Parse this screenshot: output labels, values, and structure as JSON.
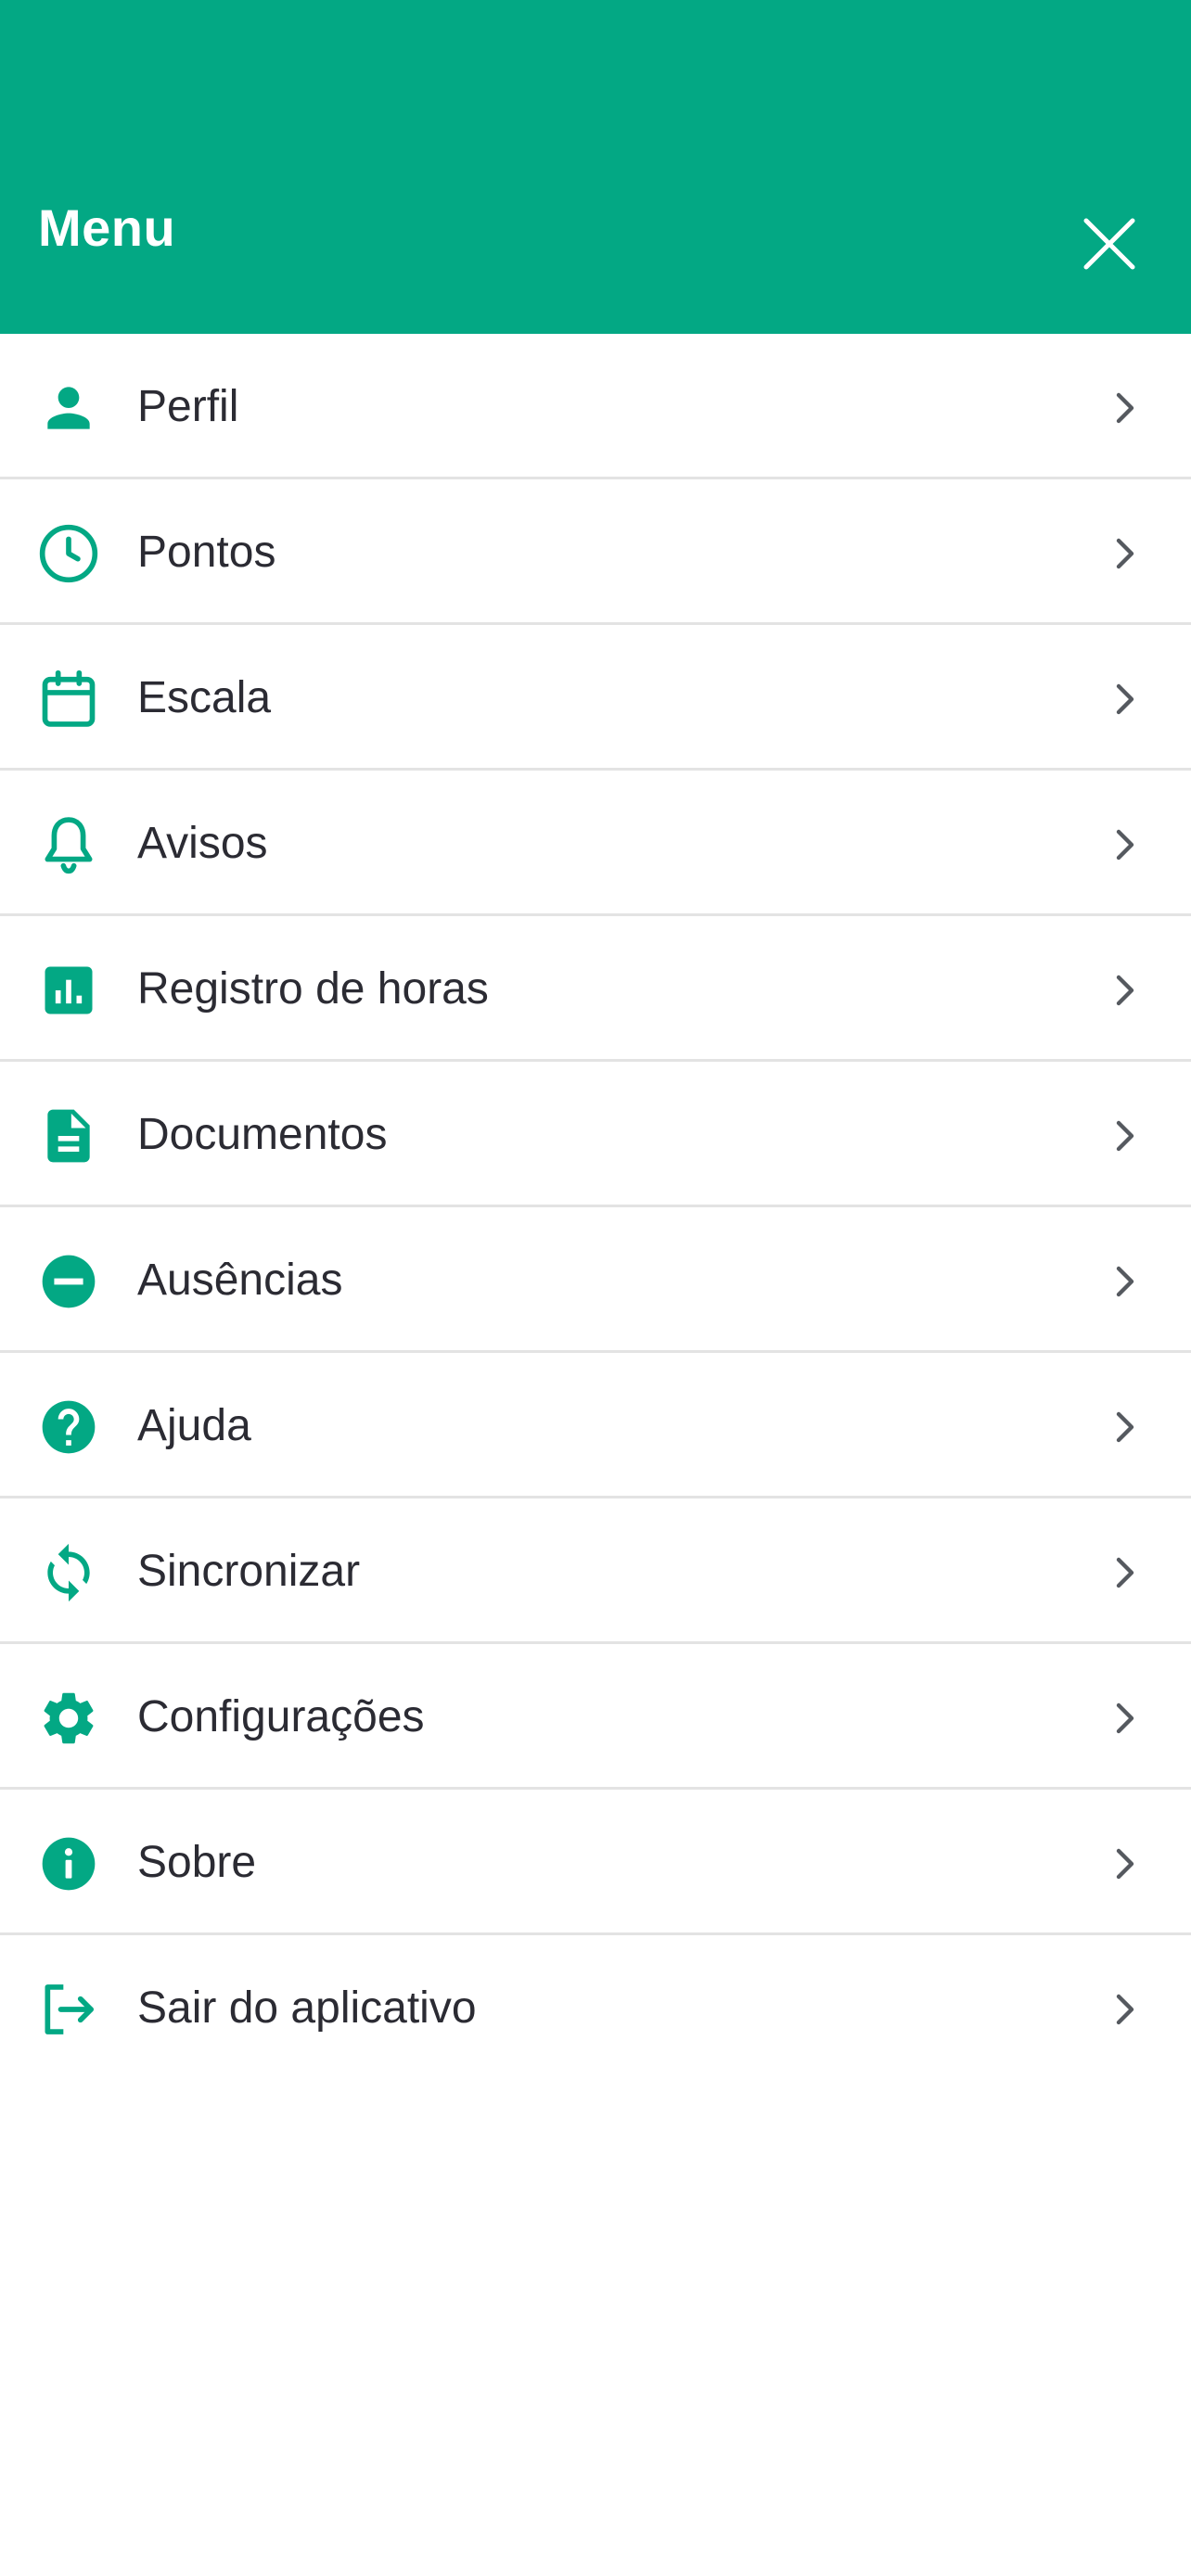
{
  "theme": {
    "accent": "#03a884",
    "text": "#2b2b33",
    "divider": "#e3e3e3",
    "chevron": "#55595f"
  },
  "header": {
    "title": "Menu",
    "close_icon": "close-icon"
  },
  "menu": {
    "items": [
      {
        "label": "Perfil",
        "icon": "person-icon"
      },
      {
        "label": "Pontos",
        "icon": "clock-icon"
      },
      {
        "label": "Escala",
        "icon": "calendar-icon"
      },
      {
        "label": "Avisos",
        "icon": "bell-icon"
      },
      {
        "label": "Registro de horas",
        "icon": "bar-chart-icon"
      },
      {
        "label": "Documentos",
        "icon": "document-icon"
      },
      {
        "label": "Ausências",
        "icon": "minus-circle-icon"
      },
      {
        "label": "Ajuda",
        "icon": "help-icon"
      },
      {
        "label": "Sincronizar",
        "icon": "sync-icon"
      },
      {
        "label": "Configurações",
        "icon": "gear-icon"
      },
      {
        "label": "Sobre",
        "icon": "info-icon"
      },
      {
        "label": "Sair do aplicativo",
        "icon": "logout-icon"
      }
    ]
  }
}
